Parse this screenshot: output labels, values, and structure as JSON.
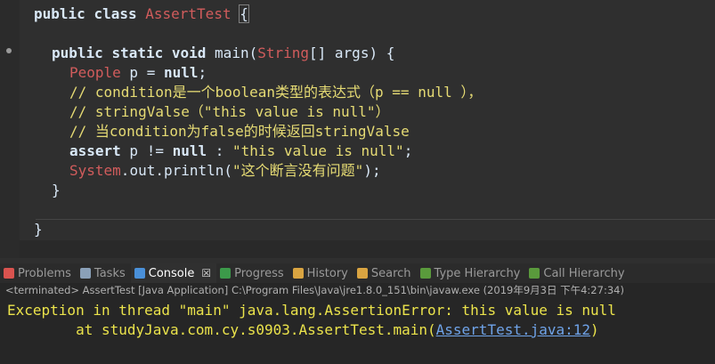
{
  "editor": {
    "line1": {
      "kw1": "public",
      "kw2": "class",
      "name": "AssertTest",
      "brace": "{"
    },
    "line2": {
      "kw1": "public",
      "kw2": "static",
      "kw3": "void",
      "method": "main(",
      "type": "String",
      "rest": "[] args) {"
    },
    "line3": {
      "type": "People",
      "rest": " p = ",
      "kw": "null",
      "end": ";"
    },
    "line4": "// condition是一个boolean类型的表达式（p == null ），",
    "line5": "// stringValse（\"this value is null\"）",
    "line6": "// 当condition为false的时候返回stringValse",
    "line7": {
      "kw": "assert",
      "mid": " p != ",
      "kw2": "null",
      "sep": " : ",
      "str": "\"this value is null\"",
      "end": ";"
    },
    "line8": {
      "cls": "System",
      "dot": ".",
      "field": "out",
      "call": ".println(",
      "str": "\"这个断言没有问题\"",
      "end": ");"
    },
    "line9": "}",
    "line10": "}"
  },
  "tabs": [
    {
      "label": "Problems",
      "icon": "problems-icon",
      "color": "#d9534f"
    },
    {
      "label": "Tasks",
      "icon": "tasks-icon",
      "color": "#8aa0b8"
    },
    {
      "label": "Console",
      "icon": "console-icon",
      "color": "#4a90d9",
      "active": true,
      "close": "☒"
    },
    {
      "label": "Progress",
      "icon": "progress-icon",
      "color": "#3c9a4a"
    },
    {
      "label": "History",
      "icon": "history-icon",
      "color": "#d9a441"
    },
    {
      "label": "Search",
      "icon": "search-icon",
      "color": "#d9a441"
    },
    {
      "label": "Type Hierarchy",
      "icon": "type-hierarchy-icon",
      "color": "#5a9a3c"
    },
    {
      "label": "Call Hierarchy",
      "icon": "call-hierarchy-icon",
      "color": "#5a9a3c"
    }
  ],
  "status": "<terminated> AssertTest [Java Application] C:\\Program Files\\Java\\jre1.8.0_151\\bin\\javaw.exe (2019年9月3日 下午4:27:34)",
  "console": {
    "line1": "Exception in thread \"main\" java.lang.AssertionError: this value is null",
    "line2_prefix": "\tat studyJava.com.cy.s0903.AssertTest.main(",
    "line2_link": "AssertTest.java:12",
    "line2_suffix": ")"
  }
}
